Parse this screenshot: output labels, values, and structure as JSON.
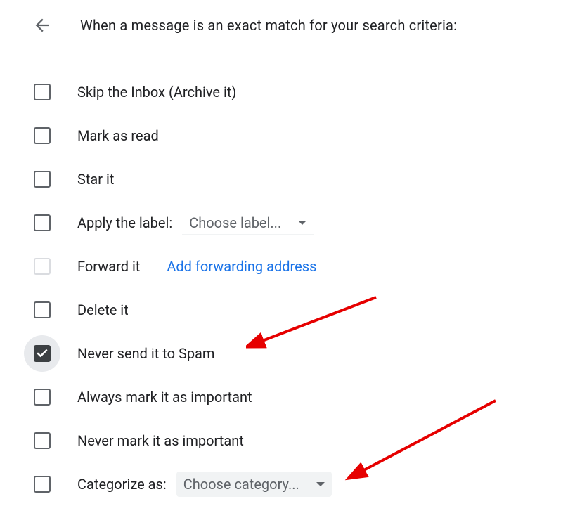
{
  "header": {
    "title": "When a message is an exact match for your search criteria:"
  },
  "options": {
    "skip_inbox": "Skip the Inbox (Archive it)",
    "mark_read": "Mark as read",
    "star_it": "Star it",
    "apply_label": "Apply the label:",
    "apply_label_dropdown": "Choose label...",
    "forward_it": "Forward it",
    "forward_link": "Add forwarding address",
    "delete_it": "Delete it",
    "never_spam": "Never send it to Spam",
    "always_important": "Always mark it as important",
    "never_important": "Never mark it as important",
    "categorize_as": "Categorize as:",
    "categorize_dropdown": "Choose category..."
  }
}
